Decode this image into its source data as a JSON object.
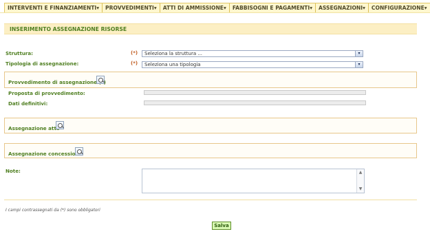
{
  "menu": {
    "items": [
      "INTERVENTI E FINANZIAMENTI",
      "PROVVEDIMENTI",
      "ATTI DI AMMISSIONE",
      "FABBISOGNI E PAGAMENTI",
      "ASSEGNAZIONI",
      "CONFIGURAZIONE"
    ],
    "dropdown_marker": "▾",
    "home_icon": "⌂",
    "help_icon": "?"
  },
  "page": {
    "title": "INSERIMENTO ASSEGNAZIONE RISORSE"
  },
  "form": {
    "required_marker": "(*)",
    "struttura": {
      "label": "Struttura:",
      "value": "Seleziona la struttura ..."
    },
    "tipologia": {
      "label": "Tipologia di assegnazione:",
      "value": "Seleziona una tipologia"
    },
    "provvedimento": {
      "title": "Provvedimento di assegnazione (*)",
      "proposta_label": "Proposta di provvedimento:",
      "dati_label": "Dati definitivi:"
    },
    "assegnazione_atto": {
      "title": "Assegnazione atto"
    },
    "assegnazione_concessione": {
      "title": "Assegnazione concessione"
    },
    "note": {
      "label": "Note:"
    }
  },
  "footer": {
    "note": "I campi contrassegnati da (*) sono obbligatori",
    "save_label": "Salva"
  },
  "colors": {
    "label_green": "#4f7f21",
    "required_orange": "#c15e23",
    "panel_border": "#e7c68a",
    "title_band": "#fcefc4",
    "save_fill": "#d8f8b2"
  }
}
